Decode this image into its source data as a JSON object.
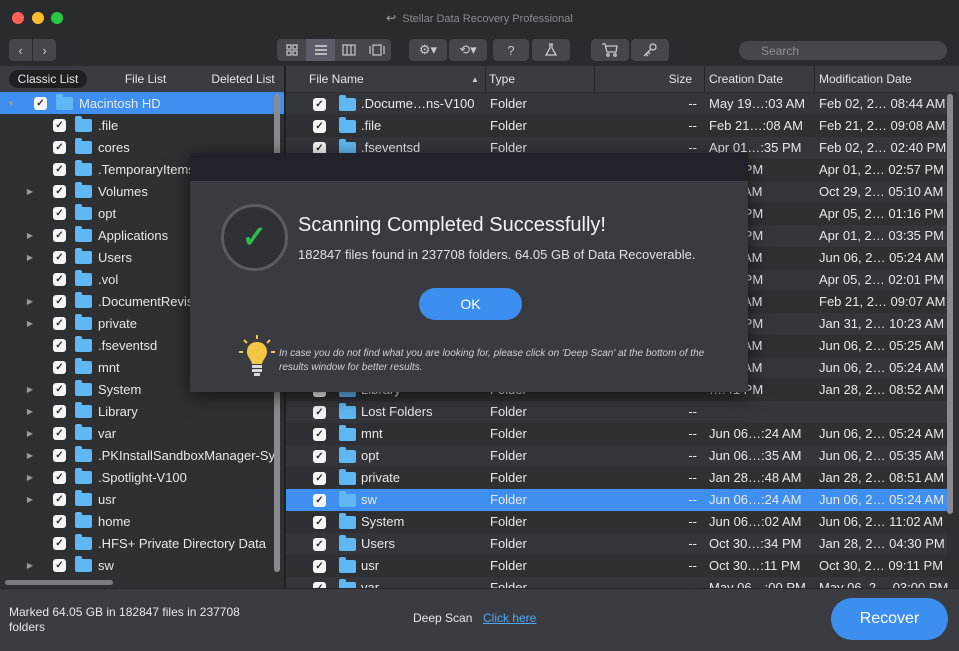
{
  "window": {
    "title": "Stellar Data Recovery Professional",
    "title_icon": "back-arrow-icon"
  },
  "toolbar": {
    "nav_back": "‹",
    "nav_fwd": "›",
    "view_icons": [
      "grid-view-icon",
      "list-view-icon",
      "column-view-icon",
      "coverflow-view-icon"
    ],
    "tools": [
      "gear-icon",
      "history-icon",
      "help-icon",
      "scan-icon",
      "cart-icon",
      "key-icon"
    ],
    "search_placeholder": "Search"
  },
  "left": {
    "tabs": [
      "Classic List",
      "File List",
      "Deleted List"
    ],
    "tree": [
      {
        "label": "Macintosh HD",
        "arrow": "▼",
        "level": 0,
        "selected": true
      },
      {
        "label": ".file",
        "arrow": "",
        "level": 1
      },
      {
        "label": "cores",
        "arrow": "",
        "level": 1
      },
      {
        "label": ".TemporaryItems",
        "arrow": "",
        "level": 1
      },
      {
        "label": "Volumes",
        "arrow": "▶",
        "level": 1
      },
      {
        "label": "opt",
        "arrow": "",
        "level": 1
      },
      {
        "label": "Applications",
        "arrow": "▶",
        "level": 1
      },
      {
        "label": "Users",
        "arrow": "▶",
        "level": 1
      },
      {
        "label": ".vol",
        "arrow": "",
        "level": 1
      },
      {
        "label": ".DocumentRevis",
        "arrow": "▶",
        "level": 1
      },
      {
        "label": "private",
        "arrow": "▶",
        "level": 1
      },
      {
        "label": ".fseventsd",
        "arrow": "",
        "level": 1
      },
      {
        "label": "mnt",
        "arrow": "",
        "level": 1
      },
      {
        "label": "System",
        "arrow": "▶",
        "level": 1
      },
      {
        "label": "Library",
        "arrow": "▶",
        "level": 1
      },
      {
        "label": "var",
        "arrow": "▶",
        "level": 1
      },
      {
        "label": ".PKInstallSandboxManager-Sy",
        "arrow": "▶",
        "level": 1
      },
      {
        "label": ".Spotlight-V100",
        "arrow": "▶",
        "level": 1
      },
      {
        "label": "usr",
        "arrow": "▶",
        "level": 1
      },
      {
        "label": "home",
        "arrow": "",
        "level": 1
      },
      {
        "label": ".HFS+ Private Directory Data",
        "arrow": "",
        "level": 1
      },
      {
        "label": "sw",
        "arrow": "▶",
        "level": 1
      }
    ]
  },
  "table": {
    "headers": {
      "name": "File Name",
      "type": "Type",
      "size": "Size",
      "created": "Creation Date",
      "modified": "Modification Date"
    },
    "rows": [
      {
        "name": ".Docume…ns-V100",
        "type": "Folder",
        "size": "--",
        "created": "May 19…:03 AM",
        "modified": "Feb 02, 2… 08:44 AM"
      },
      {
        "name": ".file",
        "type": "Folder",
        "size": "--",
        "created": "Feb 21…:08 AM",
        "modified": "Feb 21, 2… 09:08 AM"
      },
      {
        "name": ".fseventsd",
        "type": "Folder",
        "size": "--",
        "created": "Apr 01…:35 PM",
        "modified": "Feb 02, 2… 02:40 PM"
      },
      {
        "name": "",
        "type": "",
        "size": "",
        "created": "…:57 PM",
        "modified": "Apr 01, 2… 02:57 PM"
      },
      {
        "name": "",
        "type": "",
        "size": "",
        "created": "…:10 AM",
        "modified": "Oct 29, 2… 05:10 AM"
      },
      {
        "name": "",
        "type": "",
        "size": "",
        "created": "…:15 PM",
        "modified": "Apr 05, 2… 01:16 PM"
      },
      {
        "name": "",
        "type": "",
        "size": "",
        "created": "…:35 PM",
        "modified": "Apr 01, 2… 03:35 PM"
      },
      {
        "name": "",
        "type": "",
        "size": "",
        "created": "…:24 AM",
        "modified": "Jun 06, 2… 05:24 AM"
      },
      {
        "name": "",
        "type": "",
        "size": "",
        "created": "…:01 PM",
        "modified": "Apr 05, 2… 02:01 PM"
      },
      {
        "name": "",
        "type": "",
        "size": "",
        "created": "…:07 AM",
        "modified": "Feb 21, 2… 09:07 AM"
      },
      {
        "name": "",
        "type": "",
        "size": "",
        "created": "…:37 PM",
        "modified": "Jan 31, 2… 10:23 AM"
      },
      {
        "name": "",
        "type": "",
        "size": "",
        "created": "…:25 AM",
        "modified": "Jun 06, 2… 05:25 AM"
      },
      {
        "name": "",
        "type": "",
        "size": "",
        "created": "…:24 AM",
        "modified": "Jun 06, 2… 05:24 AM"
      },
      {
        "name": "Library",
        "type": "Folder",
        "size": "",
        "created": "…:41 PM",
        "modified": "Jan 28, 2… 08:52 AM"
      },
      {
        "name": "Lost Folders",
        "type": "Folder",
        "size": "--",
        "created": "",
        "modified": ""
      },
      {
        "name": "mnt",
        "type": "Folder",
        "size": "--",
        "created": "Jun 06…:24 AM",
        "modified": "Jun 06, 2… 05:24 AM"
      },
      {
        "name": "opt",
        "type": "Folder",
        "size": "--",
        "created": "Jun 06…:35 AM",
        "modified": "Jun 06, 2… 05:35 AM"
      },
      {
        "name": "private",
        "type": "Folder",
        "size": "--",
        "created": "Jan 28…:48 AM",
        "modified": "Jan 28, 2… 08:51 AM"
      },
      {
        "name": "sw",
        "type": "Folder",
        "size": "--",
        "created": "Jun 06…:24 AM",
        "modified": "Jun 06, 2… 05:24 AM",
        "selected": true
      },
      {
        "name": "System",
        "type": "Folder",
        "size": "--",
        "created": "Jun 06…:02 AM",
        "modified": "Jun 06, 2… 11:02 AM"
      },
      {
        "name": "Users",
        "type": "Folder",
        "size": "--",
        "created": "Oct 30…:34 PM",
        "modified": "Jan 28, 2… 04:30 PM"
      },
      {
        "name": "usr",
        "type": "Folder",
        "size": "--",
        "created": "Oct 30…:11 PM",
        "modified": "Oct 30, 2… 09:11 PM"
      },
      {
        "name": "var",
        "type": "Folder",
        "size": "--",
        "created": "May 06…:00 PM",
        "modified": "May 06, 2… 03:00 PM"
      }
    ]
  },
  "bottom": {
    "status": "Marked 64.05 GB in 182847 files in 237708 folders",
    "deep_scan_label": "Deep Scan",
    "deep_scan_link": "Click here",
    "recover_label": "Recover"
  },
  "modal": {
    "title": "Scanning Completed Successfully!",
    "subtitle": "182847 files found in 237708 folders. 64.05 GB of Data Recoverable.",
    "ok_label": "OK",
    "tip": "In case you do not find what you are looking for, please click on 'Deep Scan' at the bottom of the results window for better results.",
    "icon": "check-icon",
    "tip_icon": "lightbulb-icon"
  },
  "colors": {
    "accent": "#3e8ff0",
    "success": "#2bbf4a",
    "folder": "#5fb8f3"
  }
}
